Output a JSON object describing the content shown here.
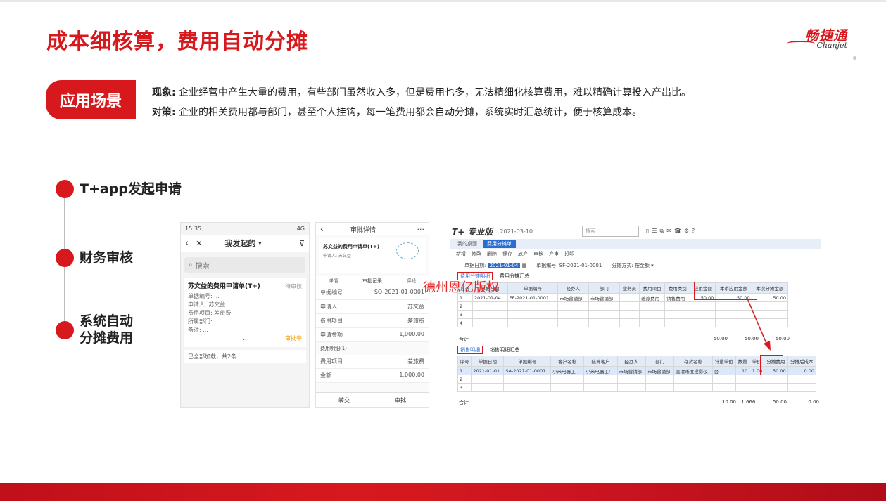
{
  "title": "成本细核算，费用自动分摊",
  "logo": {
    "cn": "畅捷通",
    "en": "Chanjet"
  },
  "scene": {
    "badge": "应用场景",
    "phenomenon_label": "现象:",
    "phenomenon": "企业经营中产生大量的费用，有些部门虽然收入多，但是费用也多，无法精细化核算费用，难以精确计算投入产出比。",
    "strategy_label": "对策:",
    "strategy": "企业的相关费用都与部门，甚至个人挂钩，每一笔费用都会自动分摊，系统实时汇总统计，便于核算成本。"
  },
  "steps": [
    {
      "label": "T+app发起申请"
    },
    {
      "label": "财务审核"
    },
    {
      "label": "系统自动",
      "label2": "分摊费用"
    }
  ],
  "phone1": {
    "time": "15:35",
    "status_right": "4G",
    "nav_title": "我发起的",
    "search": "搜索",
    "card": {
      "title": "苏文益的费用申请单(T+)",
      "status": "待审核",
      "lines": [
        "单据编号: ...",
        "申请人: 苏文益",
        "费用项目: 差旅费",
        "所属部门: ...",
        "备注: ..."
      ],
      "tag": "审批中"
    },
    "footer": "已全部加载，共2条"
  },
  "phone2": {
    "nav_title": "审批详情",
    "tabs": [
      "详情",
      "审批记录",
      "评论"
    ],
    "rows": [
      {
        "k": "单据编号",
        "v": "SQ-2021-01-0001"
      },
      {
        "k": "申请人",
        "v": "苏文益"
      },
      {
        "k": "费用项目",
        "v": "差旅费"
      },
      {
        "k": "申请金额",
        "v": "1,000.00"
      }
    ],
    "detail_title": "费用明细(1)",
    "detail_rows": [
      {
        "k": "费用项目",
        "v": "差旅费"
      },
      {
        "k": "金额",
        "v": "1,000.00"
      }
    ],
    "actions": [
      "转交",
      "审批"
    ]
  },
  "erp": {
    "brand": "T+ 专业版",
    "header_info": "2021-03-10",
    "search_placeholder": "搜索",
    "tabs": [
      "我的桌面",
      "费用分摊单"
    ],
    "toolbar": [
      "新增",
      "修改",
      "删除",
      "保存",
      "放弃",
      "审核",
      "弃审",
      "打印"
    ],
    "filter_date_label": "单据日期",
    "filter_date": "2021-01-04",
    "filter_no_label": "单据编号",
    "filter_no": "SF-2021-01-0001",
    "filter_type_label": "分摊方式",
    "filter_type": "按金额",
    "top_subtabs": [
      "费用分摊明细",
      "费用分摊汇总"
    ],
    "top_headers": [
      "序号",
      "单据日期",
      "单据编号",
      "经办人",
      "部门",
      "业务员",
      "费用项目",
      "费用类别",
      "应用金额",
      "本币应用金额",
      "本次分摊金额"
    ],
    "top_rows": [
      [
        "1",
        "2021-01-04",
        "FE-2021-01-0001",
        "市场营销部",
        "市场营销部",
        "",
        "差旅费用",
        "销售费用",
        "50.00",
        "50.00",
        "50.00"
      ]
    ],
    "top_sum": {
      "label": "合计",
      "a": "50.00",
      "b": "50.00",
      "c": "50.00"
    },
    "bottom_subtabs": [
      "销售明细",
      "销售明细汇总"
    ],
    "bottom_headers": [
      "序号",
      "单据日期",
      "单据编号",
      "客户名称",
      "结算客户",
      "经办人",
      "部门",
      "存货名称",
      "计量单位",
      "数量",
      "单价",
      "分摊费用",
      "分摊后成本"
    ],
    "bottom_rows": [
      [
        "1",
        "2021-01-01",
        "SA-2021-01-0001",
        "小米电器工厂",
        "小米电器工厂",
        "市场营销部",
        "市场营销部",
        "高清晰度投影仪",
        "台",
        "10",
        "1.00",
        "50.00",
        "0.00"
      ]
    ],
    "bottom_sum": {
      "label": "合计",
      "a": "10.00",
      "b": "1,666...",
      "c": "50.00",
      "d": "0.00"
    }
  },
  "watermark": "德州恩亿版权"
}
